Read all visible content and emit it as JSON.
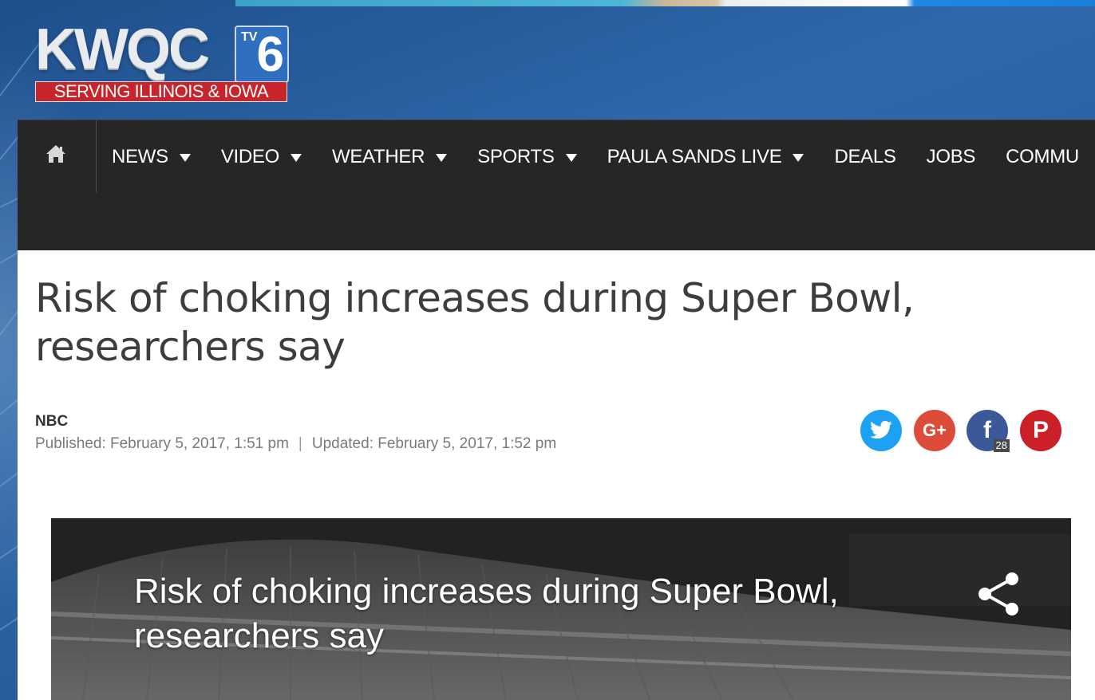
{
  "ad": {
    "present": true
  },
  "logo": {
    "brand": "KWQC",
    "tv_badge": "TV",
    "channel": "6",
    "tagline": "SERVING ILLINOIS & IOWA"
  },
  "nav": {
    "home_icon": "home-icon",
    "items": [
      {
        "label": "NEWS",
        "dropdown": true
      },
      {
        "label": "VIDEO",
        "dropdown": true
      },
      {
        "label": "WEATHER",
        "dropdown": true
      },
      {
        "label": "SPORTS",
        "dropdown": true
      },
      {
        "label": "PAULA SANDS LIVE",
        "dropdown": true
      },
      {
        "label": "DEALS",
        "dropdown": false
      },
      {
        "label": "JOBS",
        "dropdown": false
      },
      {
        "label": "COMMU",
        "dropdown": false
      }
    ]
  },
  "article": {
    "headline": "Risk of choking increases during Super Bowl, researchers say",
    "source": "NBC",
    "published": "Published: February 5, 2017, 1:51 pm",
    "separator": "|",
    "updated": "Updated: February 5, 2017, 1:52 pm"
  },
  "share": {
    "twitter_icon": "twitter-icon",
    "google_label": "G+",
    "facebook_label": "f",
    "facebook_count": "28",
    "pinterest_label": "P",
    "colors": {
      "twitter": "#1da1f2",
      "google": "#dd4b39",
      "facebook": "#3b5998",
      "pinterest": "#cb2027"
    }
  },
  "video": {
    "title": "Risk of choking increases during Super Bowl, researchers say",
    "share_icon": "share-icon"
  },
  "colors": {
    "nav_bg": "#262626",
    "page_bg": "#2b5f9c",
    "logo_red": "#c8242b",
    "headline": "#3d3d3d"
  }
}
